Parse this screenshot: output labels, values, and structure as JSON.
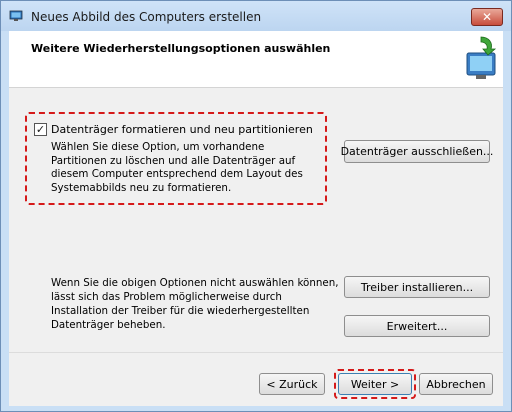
{
  "window": {
    "title": "Neues Abbild des Computers erstellen",
    "close_glyph": "✕",
    "app_icon": "backup-monitor-icon"
  },
  "header": {
    "title": "Weitere Wiederherstellungsoptionen auswählen",
    "icon": "computer-restore-icon"
  },
  "option": {
    "checked": true,
    "check_glyph": "✓",
    "label": "Datenträger formatieren und neu partitionieren",
    "description": "Wählen Sie diese Option, um vorhandene Partitionen zu löschen und alle Datenträger auf diesem Computer entsprechend dem Layout des Systemabbilds neu zu formatieren."
  },
  "buttons": {
    "exclude": "Datenträger ausschließen...",
    "install_driver": "Treiber installieren...",
    "advanced": "Erweitert..."
  },
  "info_text": "Wenn Sie die obigen Optionen nicht auswählen können, lässt sich das Problem möglicherweise durch Installation der Treiber für die wiederhergestellten Datenträger beheben.",
  "footer": {
    "back": "< Zurück",
    "next": "Weiter >",
    "cancel": "Abbrechen"
  },
  "colors": {
    "highlight": "#d51a1a",
    "title_bar": "#c9dff5"
  }
}
